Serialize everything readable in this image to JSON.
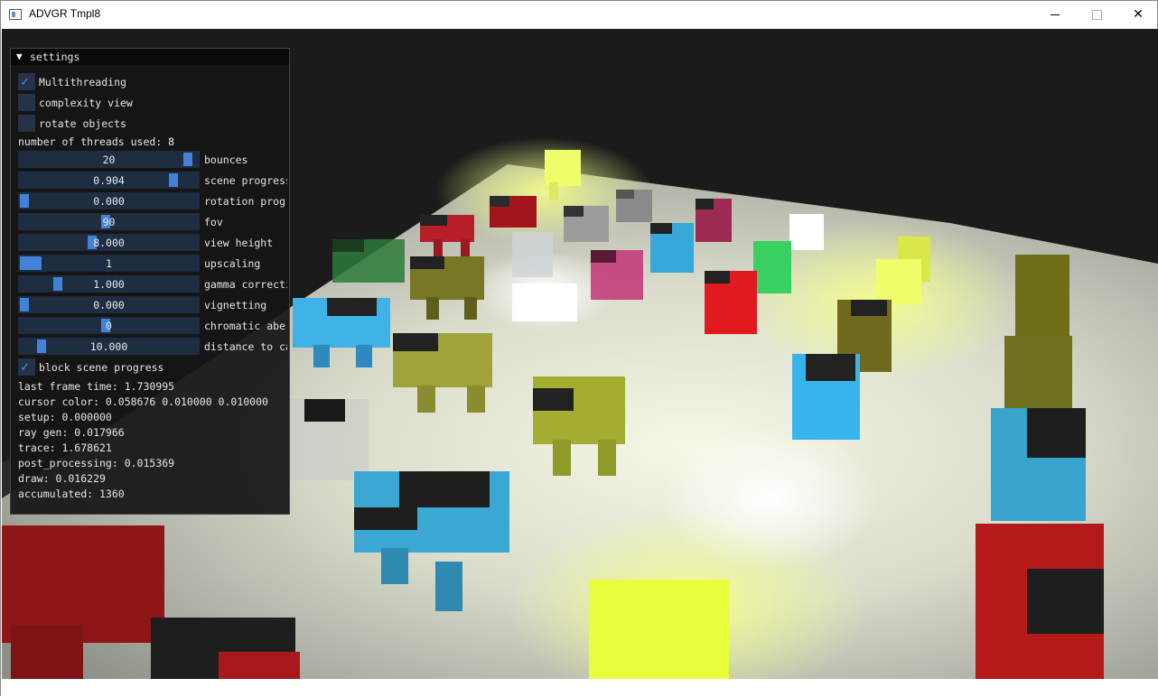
{
  "window": {
    "title": "ADVGR Tmpl8",
    "min_icon": "minimize-icon",
    "max_icon": "maximize-icon",
    "close_icon": "close-icon",
    "close_glyph": "✕"
  },
  "panel": {
    "header": "settings",
    "collapse_glyph": "▼",
    "check_glyph": "✓",
    "checkboxes": [
      {
        "label": "Multithreading",
        "checked": true
      },
      {
        "label": "complexity view",
        "checked": false
      },
      {
        "label": "rotate objects",
        "checked": false
      }
    ],
    "threads_text": "number of threads used: 8",
    "sliders": [
      {
        "value": "20",
        "label": "bounces",
        "fraction": 0.97
      },
      {
        "value": "0.904",
        "label": "scene progress",
        "fraction": 0.88
      },
      {
        "value": "0.000",
        "label": "rotation progress",
        "fraction": 0.0
      },
      {
        "value": "90",
        "label": "fov",
        "fraction": 0.48
      },
      {
        "value": "8.000",
        "label": "view height",
        "fraction": 0.4
      },
      {
        "value": "1",
        "label": "upscaling",
        "fraction": 0.0,
        "wide": true
      },
      {
        "value": "1.000",
        "label": "gamma correction",
        "fraction": 0.2
      },
      {
        "value": "0.000",
        "label": "vignetting",
        "fraction": 0.0
      },
      {
        "value": "0",
        "label": "chromatic aberration",
        "fraction": 0.48
      },
      {
        "value": "10.000",
        "label": "distance to camera",
        "fraction": 0.1
      }
    ],
    "block_checkbox": {
      "label": "block scene progress",
      "checked": true
    },
    "stats": [
      "last frame time: 1.730995",
      "cursor color: 0.058676 0.010000 0.010000",
      "setup: 0.000000",
      "ray gen: 0.017966",
      "trace: 1.678621",
      "post_processing: 0.015369",
      "draw: 0.016229",
      "accumulated: 1360"
    ]
  },
  "colors": {
    "accent": "#4282d8",
    "frame_bg": "#1f2d42",
    "panel_bg": "#141414"
  }
}
